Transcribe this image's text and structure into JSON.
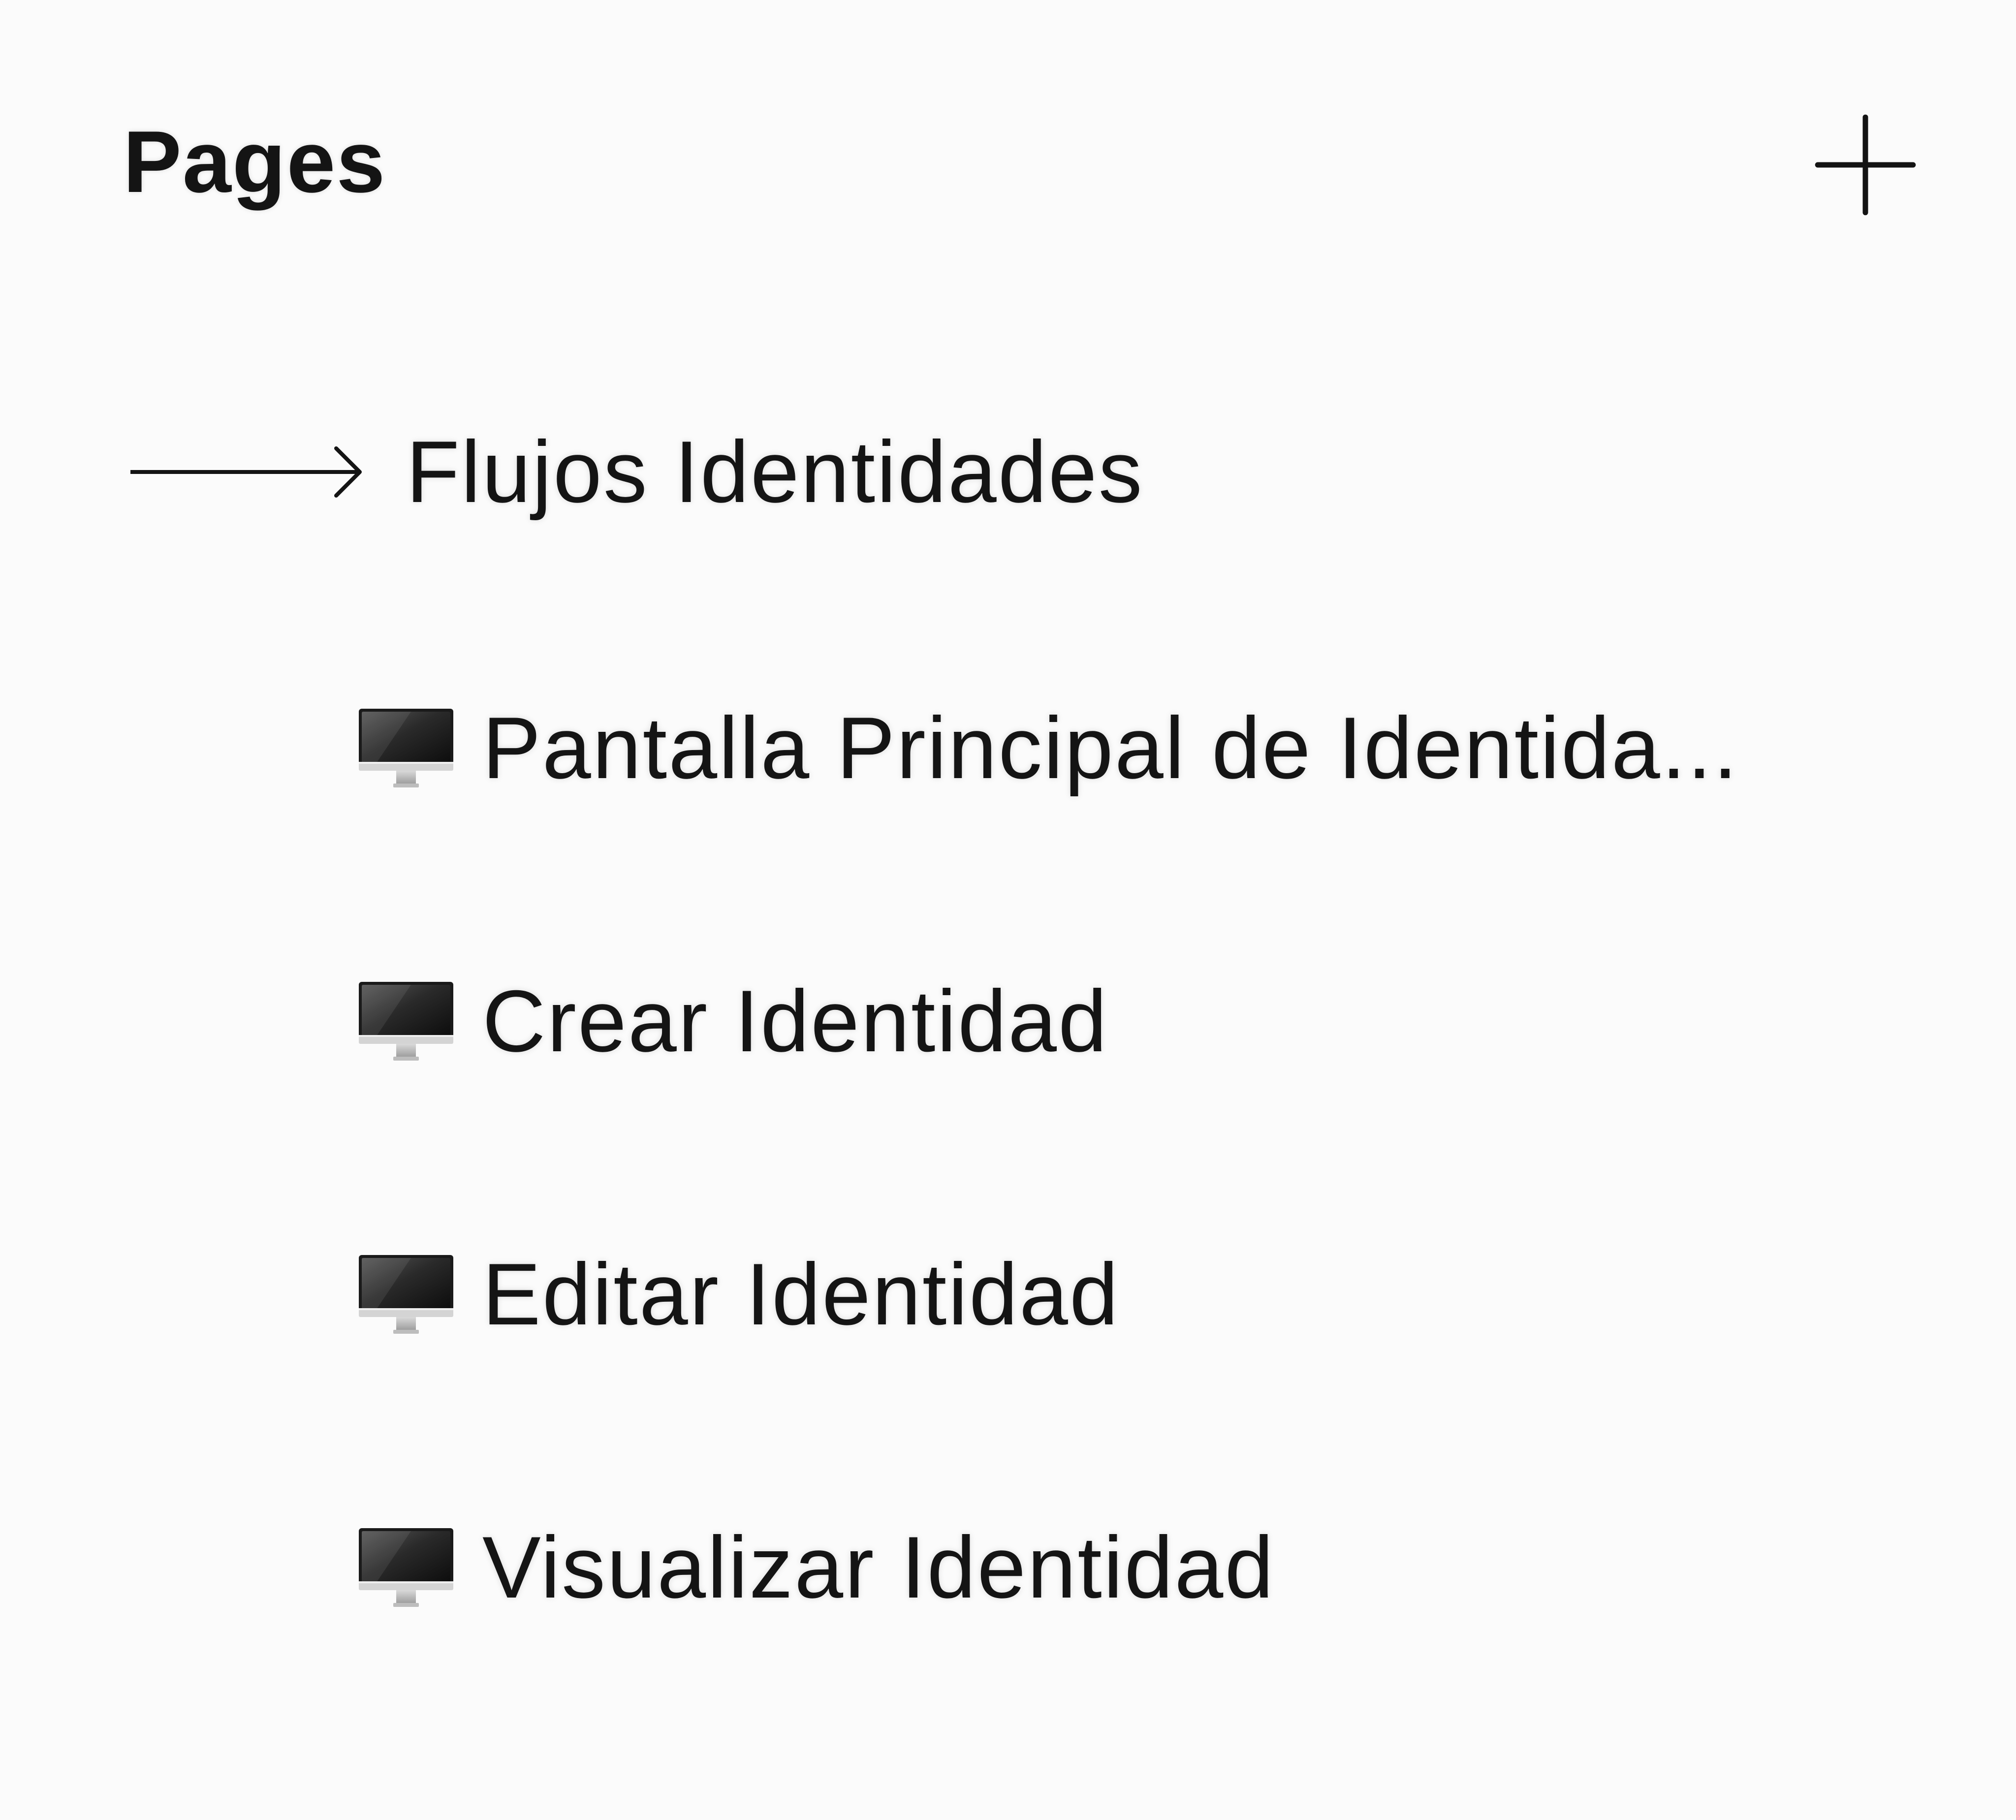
{
  "header": {
    "title": "Pages",
    "add_icon": "plus-icon"
  },
  "section": {
    "icon": "arrow-right-icon",
    "label": "Flujos Identidades"
  },
  "pages": [
    {
      "icon": "desktop-computer-icon",
      "label": "Pantalla Principal de Identida..."
    },
    {
      "icon": "desktop-computer-icon",
      "label": "Crear Identidad"
    },
    {
      "icon": "desktop-computer-icon",
      "label": "Editar Identidad"
    },
    {
      "icon": "desktop-computer-icon",
      "label": "Visualizar Identidad"
    }
  ],
  "colors": {
    "background": "#fbfbfb",
    "text": "#141414"
  }
}
